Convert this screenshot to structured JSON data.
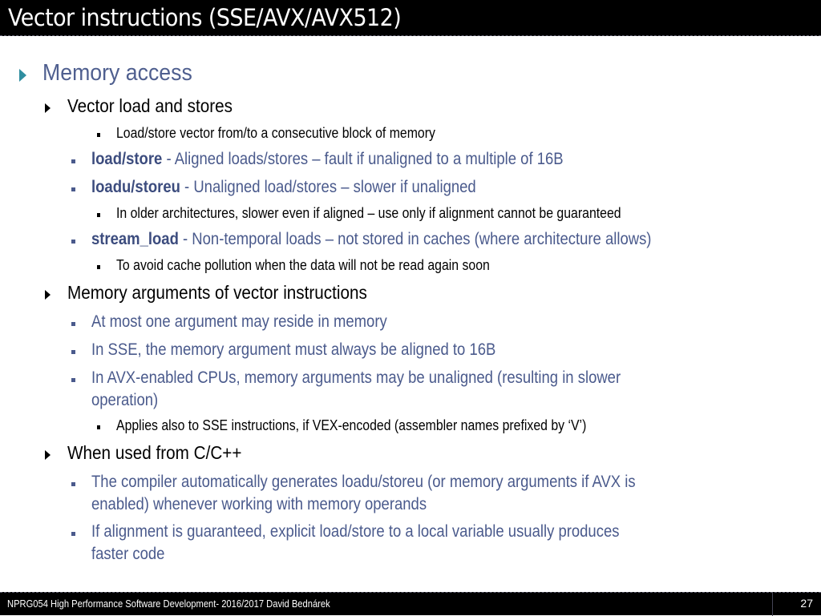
{
  "slide": {
    "title": "Vector instructions (SSE/AVX/AVX512)",
    "heading": "Memory access",
    "sections": [
      {
        "label": "Vector load and stores",
        "sub_note": "Load/store vector from/to a consecutive block of memory",
        "items": [
          {
            "keyword": "load/store",
            "text": " - Aligned loads/stores – fault if unaligned to a multiple of 16B"
          },
          {
            "keyword": "loadu/storeu",
            "text": " - Unaligned load/stores – slower if unaligned",
            "note": "In older architectures, slower even if aligned – use only if alignment cannot be guaranteed"
          },
          {
            "keyword": "stream_load",
            "text": " - Non-temporal loads – not stored in caches (where architecture allows)",
            "note": "To avoid cache pollution when the data will not be read again soon"
          }
        ]
      },
      {
        "label": "Memory arguments of vector instructions",
        "items": [
          {
            "text": "At most one argument may reside in memory"
          },
          {
            "text": "In SSE, the memory argument must always be aligned to 16B"
          },
          {
            "text_line1": "In AVX-enabled CPUs, memory arguments may be unaligned (resulting in slower",
            "text_line2": "operation)",
            "note": "Applies also to SSE instructions, if VEX-encoded (assembler names prefixed by ‘V’)"
          }
        ]
      },
      {
        "label": "When used from C/C++",
        "items": [
          {
            "text_line1": "The compiler automatically generates loadu/storeu (or memory arguments if AVX is",
            "text_line2": "enabled) whenever working with memory operands"
          },
          {
            "text_line1": "If alignment is guaranteed, explicit load/store to a local variable usually produces",
            "text_line2": "faster code"
          }
        ]
      }
    ]
  },
  "footer": {
    "text": "NPRG054 High Performance Software Development- 2016/2017 David Bednárek",
    "page_number": "27"
  },
  "colors": {
    "heading_blue": "#4f5f8f",
    "bullet_teal": "#2f8ea0",
    "body_blue": "#4a5a8c",
    "bar_black": "#000000"
  }
}
